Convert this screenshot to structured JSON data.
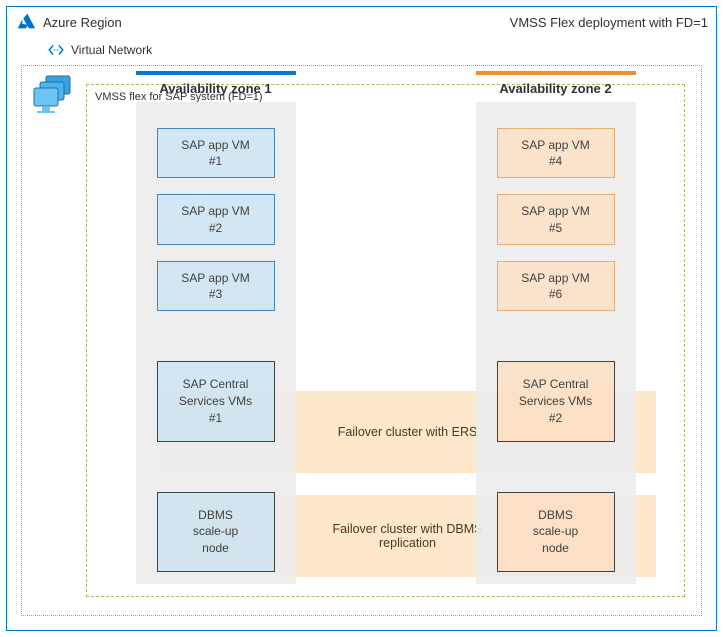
{
  "header": {
    "region_label": "Azure Region",
    "subtitle": "VMSS Flex deployment with FD=1"
  },
  "vnet": {
    "label": "Virtual Network"
  },
  "vmss": {
    "label": "VMSS flex for SAP system (FD=1)"
  },
  "zone1": {
    "title": "Availability zone 1",
    "sap_app_vms": [
      {
        "label": "SAP app VM",
        "num": "#1"
      },
      {
        "label": "SAP app VM",
        "num": "#2"
      },
      {
        "label": "SAP app VM",
        "num": "#3"
      }
    ],
    "central": {
      "l1": "SAP Central",
      "l2": "Services VMs",
      "l3": "#1"
    },
    "dbms": {
      "l1": "DBMS",
      "l2": "scale-up",
      "l3": "node"
    }
  },
  "zone2": {
    "title": "Availability zone 2",
    "sap_app_vms": [
      {
        "label": "SAP app VM",
        "num": "#4"
      },
      {
        "label": "SAP app VM",
        "num": "#5"
      },
      {
        "label": "SAP app VM",
        "num": "#6"
      }
    ],
    "central": {
      "l1": "SAP Central",
      "l2": "Services VMs",
      "l3": "#2"
    },
    "dbms": {
      "l1": "DBMS",
      "l2": "scale-up",
      "l3": "node"
    }
  },
  "clusters": {
    "ers": "Failover cluster with ERS",
    "dbms": "Failover cluster with DBMS replication"
  }
}
